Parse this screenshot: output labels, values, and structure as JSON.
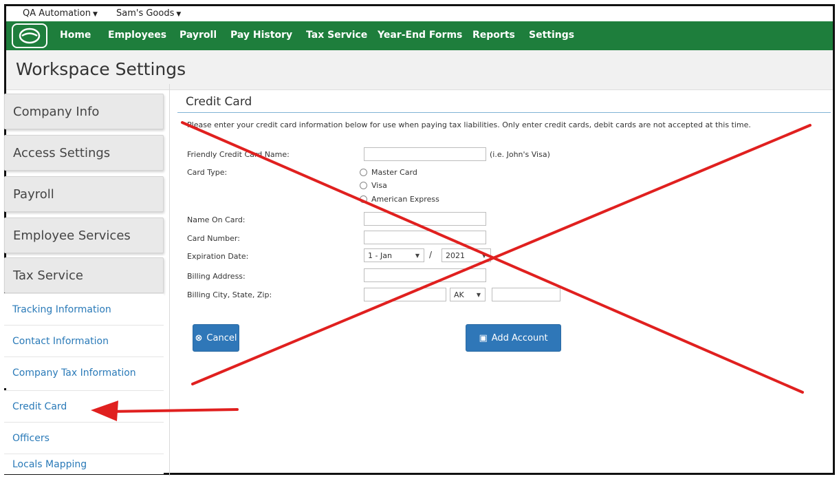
{
  "context": {
    "org": "QA Automation",
    "company": "Sam's Goods"
  },
  "nav": {
    "items": [
      "Home",
      "Employees",
      "Payroll",
      "Pay History",
      "Tax Service",
      "Year-End Forms",
      "Reports",
      "Settings"
    ]
  },
  "page": {
    "title": "Workspace Settings"
  },
  "sidebar": {
    "sections": [
      "Company Info",
      "Access Settings",
      "Payroll",
      "Employee Services",
      "Tax Service"
    ],
    "links": [
      "Tracking Information",
      "Contact Information",
      "Company Tax Information",
      "Credit Card",
      "Officers",
      "Locals Mapping"
    ]
  },
  "form": {
    "title": "Credit Card",
    "intro": "Please enter your credit card information below for use when paying tax liabilities. Only enter credit cards, debit cards are not accepted at this time.",
    "friendly_name_label": "Friendly Credit Card Name:",
    "friendly_name_hint": "(i.e. John's Visa)",
    "card_type_label": "Card Type:",
    "card_types": [
      "Master Card",
      "Visa",
      "American Express"
    ],
    "name_on_card_label": "Name On Card:",
    "card_number_label": "Card Number:",
    "expiration_label": "Expiration Date:",
    "exp_month": "1 - Jan",
    "exp_separator": "/",
    "exp_year": "2021",
    "billing_address_label": "Billing Address:",
    "billing_csz_label": "Billing City, State, Zip:",
    "state_value": "AK",
    "cancel_label": "Cancel",
    "add_account_label": "Add Account"
  },
  "colors": {
    "nav": "#1e7e3c",
    "button": "#2f77b8",
    "link": "#2a7ab8",
    "annotation": "#e0201f"
  }
}
